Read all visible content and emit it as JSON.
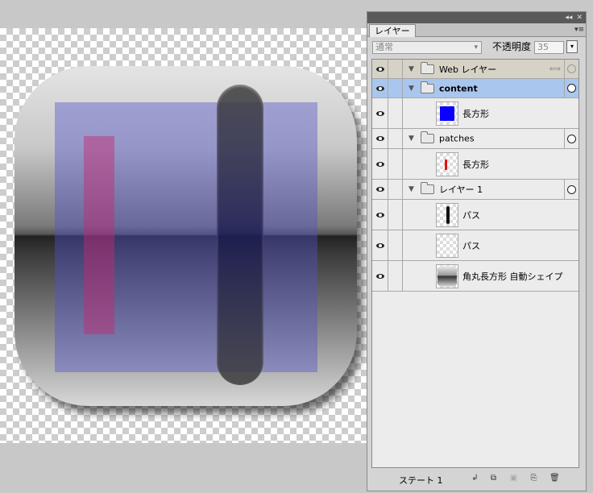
{
  "panel": {
    "tab_label": "レイヤー",
    "collapse_icon": "◂◂",
    "close_icon": "✕",
    "menu_icon": "▾≡",
    "blend_mode": "通常",
    "opacity_label": "不透明度",
    "opacity_value": "35",
    "dropdown_icon": "▾"
  },
  "layers": [
    {
      "name": "Web レイヤー",
      "type": "web-folder"
    },
    {
      "name": "content",
      "type": "folder",
      "selected": true
    },
    {
      "name": "長方形",
      "type": "object",
      "thumb": "blue"
    },
    {
      "name": "patches",
      "type": "folder"
    },
    {
      "name": "長方形",
      "type": "object",
      "thumb": "red"
    },
    {
      "name": "レイヤー 1",
      "type": "folder"
    },
    {
      "name": "パス",
      "type": "object",
      "thumb": "pill"
    },
    {
      "name": "パス",
      "type": "object",
      "thumb": "empty"
    },
    {
      "name": "角丸長方形 自動シェイプ",
      "type": "object",
      "thumb": "gradient"
    }
  ],
  "footer": {
    "state_label": "ステート 1",
    "icons": [
      "new-sublayer-icon",
      "add-layer-icon",
      "add-mask-icon",
      "new-duplicate-icon",
      "trash-icon"
    ]
  },
  "colors": {
    "selected_row": "#a9c6ee",
    "web_layer_row": "#d6d2c6",
    "content_rect": "#0a00ff",
    "patch_rect": "#e51010"
  }
}
